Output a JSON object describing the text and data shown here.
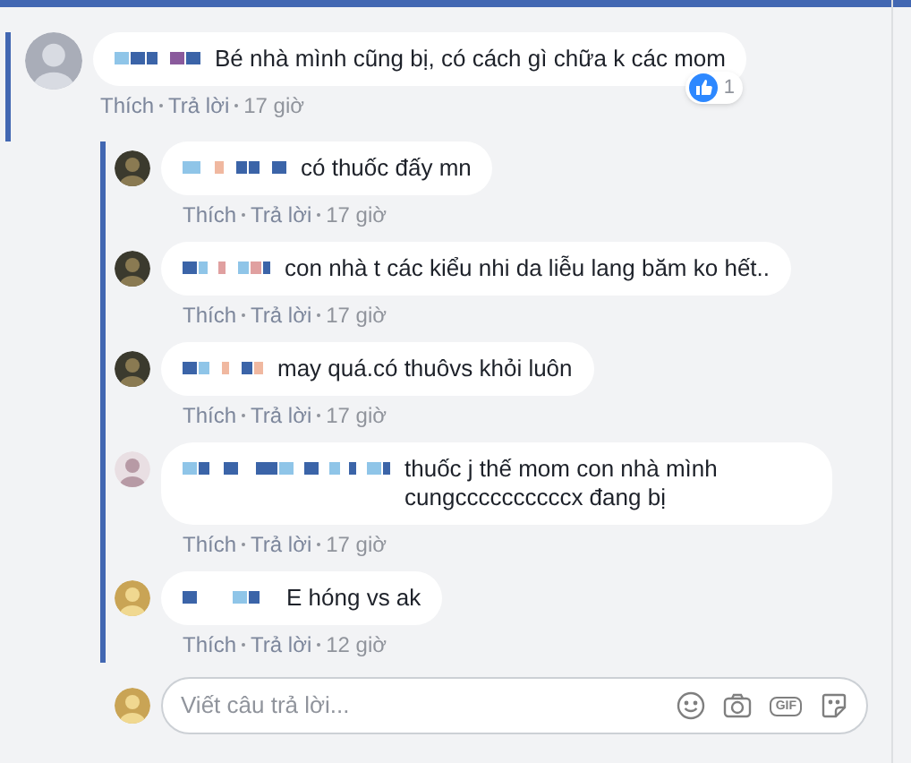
{
  "comment": {
    "text": "Bé nhà mình cũng bị, có cách gì chữa k các mom",
    "like": "Thích",
    "reply": "Trả lời",
    "time": "17 giờ",
    "reaction_count": "1"
  },
  "replies": [
    {
      "text": "có thuốc đấy mn",
      "like": "Thích",
      "reply": "Trả lời",
      "time": "17 giờ"
    },
    {
      "text": "con nhà t các kiểu nhi da liễu lang băm ko hết..",
      "like": "Thích",
      "reply": "Trả lời",
      "time": "17 giờ"
    },
    {
      "text": "may quá.có thuôvs khỏi luôn",
      "like": "Thích",
      "reply": "Trả lời",
      "time": "17 giờ"
    },
    {
      "text": "thuốc j thế mom con nhà mình cungccccccccccx đang bị",
      "like": "Thích",
      "reply": "Trả lời",
      "time": "17 giờ"
    },
    {
      "text": "E hóng vs ak",
      "like": "Thích",
      "reply": "Trả lời",
      "time": "12 giờ"
    }
  ],
  "reply_field": {
    "placeholder": "Viết câu trả lời...",
    "gif_label": "GIF"
  }
}
